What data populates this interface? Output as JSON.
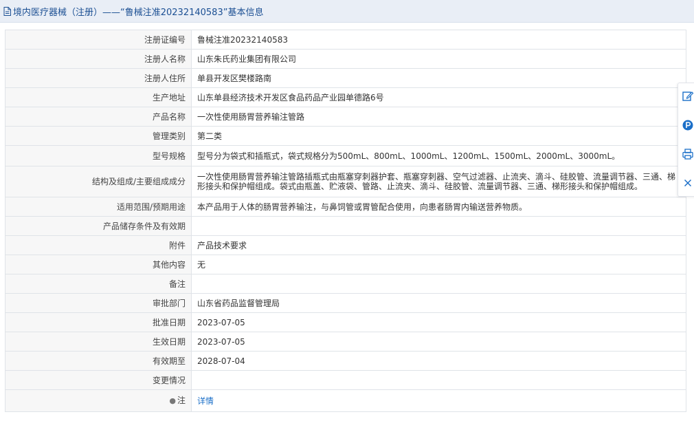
{
  "header": {
    "title": "境内医疗器械（注册）——“鲁械注准20232140583”基本信息"
  },
  "rows": [
    {
      "label": "注册证编号",
      "value": "鲁械注准20232140583"
    },
    {
      "label": "注册人名称",
      "value": "山东朱氏药业集团有限公司"
    },
    {
      "label": "注册人住所",
      "value": "单县开发区樊楼路南"
    },
    {
      "label": "生产地址",
      "value": "山东单县经济技术开发区食品药品产业园单德路6号"
    },
    {
      "label": "产品名称",
      "value": "一次性使用肠胃营养输注管路"
    },
    {
      "label": "管理类别",
      "value": "第二类"
    },
    {
      "label": "型号规格",
      "value": "型号分为袋式和插瓶式，袋式规格分为500mL、800mL、1000mL、1200mL、1500mL、2000mL、3000mL。"
    },
    {
      "label": "结构及组成/主要组成成分",
      "value": "一次性使用肠胃营养输注管路插瓶式由瓶塞穿刺器护套、瓶塞穿刺器、空气过滤器、止流夹、滴斗、硅胶管、流量调节器、三通、梯形接头和保护帽组成。袋式由瓶盖、贮液袋、管路、止流夹、滴斗、硅胶管、流量调节器、三通、梯形接头和保护帽组成。"
    },
    {
      "label": "适用范围/预期用途",
      "value": "本产品用于人体的肠胃营养输注，与鼻饲管或胃管配合使用，向患者肠胃内输送营养物质。"
    },
    {
      "label": "产品储存条件及有效期",
      "value": ""
    },
    {
      "label": "附件",
      "value": "产品技术要求"
    },
    {
      "label": "其他内容",
      "value": "无"
    },
    {
      "label": "备注",
      "value": ""
    },
    {
      "label": "审批部门",
      "value": "山东省药品监督管理局"
    },
    {
      "label": "批准日期",
      "value": "2023-07-05"
    },
    {
      "label": "生效日期",
      "value": "2023-07-05"
    },
    {
      "label": "有效期至",
      "value": "2028-07-04"
    },
    {
      "label": "变更情况",
      "value": ""
    },
    {
      "label": "注",
      "value": "详情"
    }
  ],
  "side_tools": [
    "edit-icon",
    "parking-icon",
    "print-icon",
    "close-icon"
  ],
  "colors": {
    "title_text": "#1b4f93",
    "title_bg": "#e9eef6",
    "label_bg": "#f7f7f7",
    "link": "#1b6fc8",
    "side_icon": "#1b6fc8"
  }
}
